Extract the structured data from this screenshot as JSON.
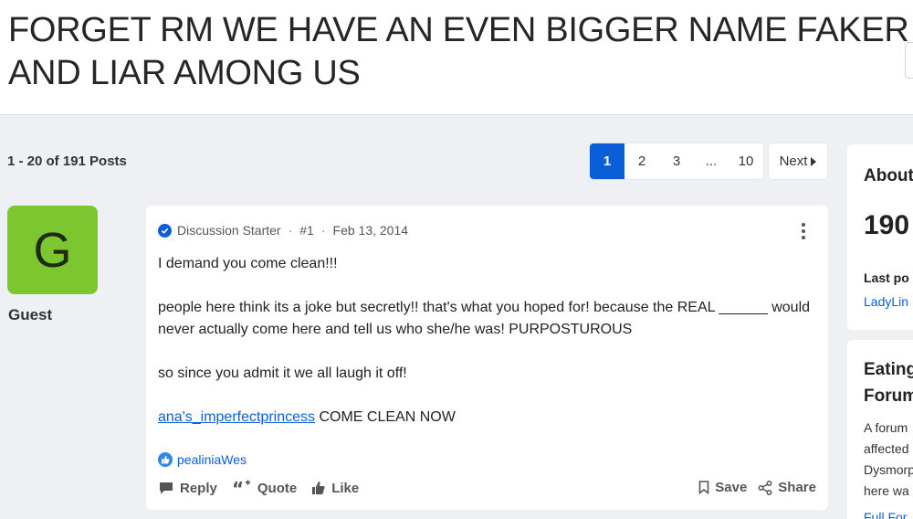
{
  "thread": {
    "title": "FORGET RM WE HAVE AN EVEN BIGGER NAME FAKER AND LIAR AMONG US"
  },
  "posts_summary": "1 - 20 of 191 Posts",
  "pagination": {
    "pages": [
      "1",
      "2",
      "3",
      "...",
      "10"
    ],
    "current": "1",
    "next_label": "Next"
  },
  "sidebar": {
    "about_heading": "About",
    "members_count": "190",
    "last_post_label": "Last po",
    "last_post_user": "LadyLin",
    "forum_heading_1": "Eating",
    "forum_heading_2": "Forum",
    "desc_lines": [
      "A forum",
      "affected",
      "Dysmorp",
      "here wa"
    ],
    "full_link": "Full For"
  },
  "post": {
    "author_initial": "G",
    "author_name": "Guest",
    "badge": "Discussion Starter",
    "number": "#1",
    "date": "Feb 13, 2014",
    "body": {
      "line1": "I demand you come clean!!!",
      "line2": "people here think its a joke but secretly!! that's what you hoped for! because the REAL ______ would never actually come here and tell us who she/he was! PURPOSTUROUS",
      "line3": "so since you admit it we all laugh it off!",
      "mention": "ana's_imperfectprincess",
      "line4_rest": " COME CLEAN NOW"
    },
    "reaction_user": "pealiniaWes",
    "actions": {
      "reply": "Reply",
      "quote": "Quote",
      "like": "Like",
      "save": "Save",
      "share": "Share"
    }
  },
  "colors": {
    "accent": "#0a5fd9",
    "avatar_bg": "#7cc72f",
    "page_bg": "#eef0f3"
  }
}
